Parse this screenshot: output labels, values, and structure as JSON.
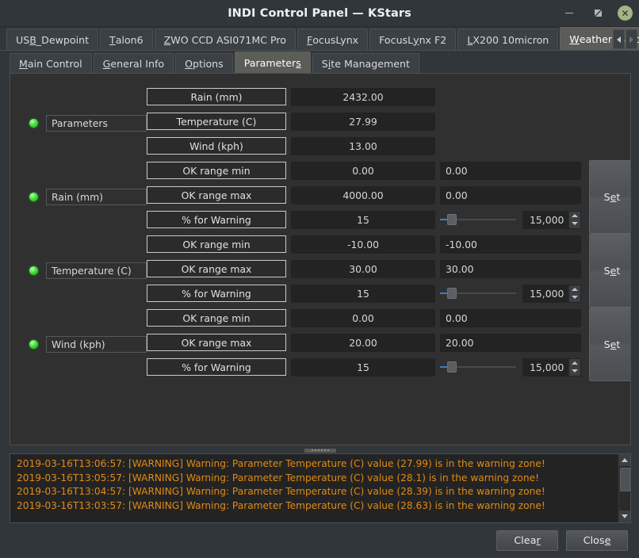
{
  "window": {
    "title": "INDI Control Panel — KStars",
    "minimize_label": "minimize",
    "restore_label": "restore",
    "close_label": "close"
  },
  "device_tabs": [
    {
      "pre": "US",
      "mn": "B",
      "post": "_Dewpoint",
      "selected": false
    },
    {
      "pre": "",
      "mn": "T",
      "post": "alon6",
      "selected": false
    },
    {
      "pre": "",
      "mn": "Z",
      "post": "WO CCD ASI071MC Pro",
      "selected": false
    },
    {
      "pre": "",
      "mn": "F",
      "post": "ocusLynx",
      "selected": false
    },
    {
      "pre": "FocusL",
      "mn": "y",
      "post": "nx F2",
      "selected": false
    },
    {
      "pre": "",
      "mn": "L",
      "post": "X200 10micron",
      "selected": false
    },
    {
      "pre": "",
      "mn": "W",
      "post": "eather Watcher",
      "selected": true
    }
  ],
  "tab_scroll": {
    "left": "scroll-tabs-left",
    "right": "scroll-tabs-right"
  },
  "property_tabs": [
    {
      "pre": "",
      "mn": "M",
      "post": "ain Control",
      "selected": false
    },
    {
      "pre": "",
      "mn": "G",
      "post": "eneral Info",
      "selected": false
    },
    {
      "pre": "",
      "mn": "O",
      "post": "ptions",
      "selected": false
    },
    {
      "pre": "Parameter",
      "mn": "s",
      "post": "",
      "selected": true
    },
    {
      "pre": "S",
      "mn": "i",
      "post": "te Management",
      "selected": false
    }
  ],
  "groups": [
    {
      "name": "Parameters",
      "led": "ok",
      "has_set": false,
      "rows": [
        {
          "label": "Rain (mm)",
          "value": "2432.00",
          "edit": null,
          "slider": null
        },
        {
          "label": "Temperature (C)",
          "value": "27.99",
          "edit": null,
          "slider": null
        },
        {
          "label": "Wind (kph)",
          "value": "13.00",
          "edit": null,
          "slider": null
        }
      ]
    },
    {
      "name": "Rain (mm)",
      "led": "ok",
      "has_set": true,
      "set_label_pre": "S",
      "set_label_mn": "e",
      "set_label_post": "t",
      "rows": [
        {
          "label": "OK range min",
          "value": "0.00",
          "edit": "0.00",
          "slider": null
        },
        {
          "label": "OK range max",
          "value": "4000.00",
          "edit": "0.00",
          "slider": null
        },
        {
          "label": "% for Warning",
          "value": "15",
          "edit": null,
          "slider": {
            "spin_value": "15,000",
            "fill_pct": 10
          }
        }
      ]
    },
    {
      "name": "Temperature (C)",
      "led": "ok",
      "has_set": true,
      "set_label_pre": "S",
      "set_label_mn": "e",
      "set_label_post": "t",
      "rows": [
        {
          "label": "OK range min",
          "value": "-10.00",
          "edit": "-10.00",
          "slider": null
        },
        {
          "label": "OK range max",
          "value": "30.00",
          "edit": "30.00",
          "slider": null
        },
        {
          "label": "% for Warning",
          "value": "15",
          "edit": null,
          "slider": {
            "spin_value": "15,000",
            "fill_pct": 10
          }
        }
      ]
    },
    {
      "name": "Wind (kph)",
      "led": "ok",
      "has_set": true,
      "set_label_pre": "S",
      "set_label_mn": "e",
      "set_label_post": "t",
      "rows": [
        {
          "label": "OK range min",
          "value": "0.00",
          "edit": "0.00",
          "slider": null
        },
        {
          "label": "OK range max",
          "value": "20.00",
          "edit": "20.00",
          "slider": null
        },
        {
          "label": "% for Warning",
          "value": "15",
          "edit": null,
          "slider": {
            "spin_value": "15,000",
            "fill_pct": 10
          }
        }
      ]
    }
  ],
  "log": {
    "lines": [
      "2019-03-16T13:06:57: [WARNING] Warning: Parameter Temperature (C) value (27.99) is in the warning zone!",
      "2019-03-16T13:05:57: [WARNING] Warning: Parameter Temperature (C) value (28.1) is in the warning zone!",
      "2019-03-16T13:04:57: [WARNING] Warning: Parameter Temperature (C) value (28.39) is in the warning zone!",
      "2019-03-16T13:03:57: [WARNING] Warning: Parameter Temperature (C) value (28.63) is in the warning zone!"
    ],
    "warning_color": "#e08a16"
  },
  "footer": {
    "clear": {
      "pre": "Clea",
      "mn": "r",
      "post": ""
    },
    "close": {
      "pre": "Clos",
      "mn": "e",
      "post": ""
    }
  }
}
